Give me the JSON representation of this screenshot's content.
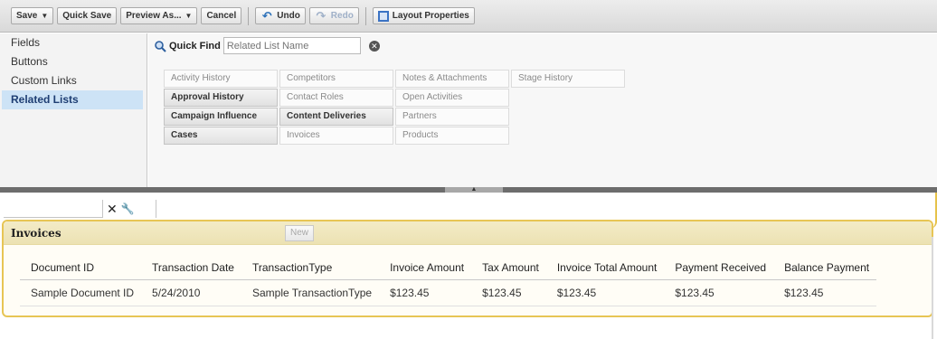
{
  "toolbar": {
    "save": "Save",
    "quick_save": "Quick Save",
    "preview_as": "Preview As...",
    "cancel": "Cancel",
    "undo": "Undo",
    "redo": "Redo",
    "layout_properties": "Layout Properties"
  },
  "categories": {
    "items": [
      "Fields",
      "Buttons",
      "Custom Links",
      "Related Lists"
    ],
    "selected": "Related Lists"
  },
  "quick_find": {
    "label": "Quick Find",
    "placeholder": "Related List Name"
  },
  "palette": {
    "col1": [
      "Activity History",
      "Approval History",
      "Campaign Influence",
      "Cases"
    ],
    "col2": [
      "Competitors",
      "Contact Roles",
      "Content Deliveries",
      "Invoices"
    ],
    "col3": [
      "Notes & Attachments",
      "Open Activities",
      "Partners",
      "Products"
    ],
    "col4": [
      "Stage History"
    ]
  },
  "section": {
    "title": "Invoices",
    "new_button": "New",
    "columns": [
      "Document ID",
      "Transaction Date",
      "TransactionType",
      "Invoice Amount",
      "Tax Amount",
      "Invoice Total Amount",
      "Payment Received",
      "Balance Payment"
    ],
    "row": [
      "Sample Document ID",
      "5/24/2010",
      "Sample TransactionType",
      "$123.45",
      "$123.45",
      "$123.45",
      "$123.45",
      "$123.45"
    ]
  },
  "colors": {
    "accent": "#e7c555",
    "selected": "#cde3f6"
  }
}
